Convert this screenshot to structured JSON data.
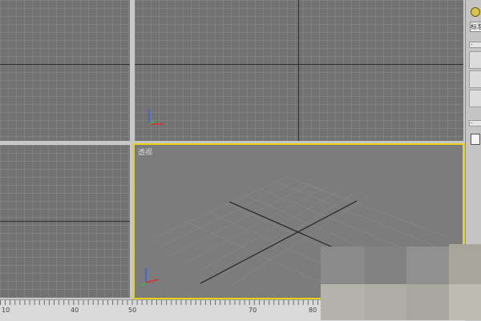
{
  "viewports": {
    "perspective": {
      "label": "透视",
      "active": true,
      "border_color": "#e6d21a"
    }
  },
  "command_panel": {
    "dropdown_value": "标准",
    "rollout_collapse_symbol": "-",
    "rollout_expand_symbol": "-"
  },
  "timeline": {
    "tick_labels": [
      "10",
      "40",
      "50",
      "70",
      "80"
    ]
  },
  "colors": {
    "viewport_bg": "#727272",
    "grid": "#808080",
    "axis": "#303030",
    "active_border": "#e6d21a"
  }
}
